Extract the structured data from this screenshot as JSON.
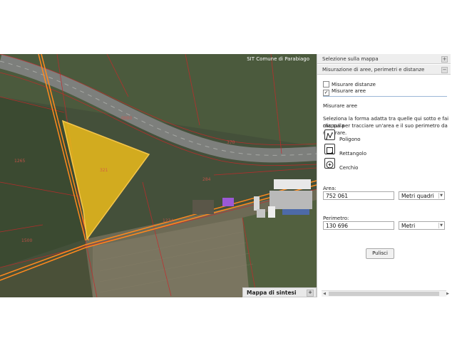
{
  "map": {
    "credit": "SIT Comune di Parabiago",
    "overview_panel": {
      "title": "Mappa di sintesi",
      "toggle": "+"
    },
    "selection_color": "#f2c01a"
  },
  "panel": {
    "sections": [
      {
        "title": "Selezione sulla mappa",
        "toggle": "+"
      },
      {
        "title": "Misurazione di aree, perimetri e distanze",
        "toggle": "−"
      }
    ],
    "checkboxes": [
      {
        "label": "Misurare distanze",
        "checked": false
      },
      {
        "label": "Misurare aree",
        "checked": true
      }
    ],
    "heading": "Misurare aree",
    "instructions": [
      "Seleziona la forma adatta tra quelle qui sotto e fai clic sulla",
      "mappa per tracciare un'area e il suo perimetro da misurare."
    ],
    "tools": [
      {
        "label": "Poligono",
        "icon": "polygon-icon"
      },
      {
        "label": "Rettangolo",
        "icon": "rectangle-icon"
      },
      {
        "label": "Cerchio",
        "icon": "circle-icon"
      }
    ],
    "area": {
      "label": "Area:",
      "value": "752 061",
      "unit": "Metri quadri"
    },
    "perimeter": {
      "label": "Perimetro:",
      "value": "130 696",
      "unit": "Metri"
    },
    "clear_button": "Pulisci"
  }
}
